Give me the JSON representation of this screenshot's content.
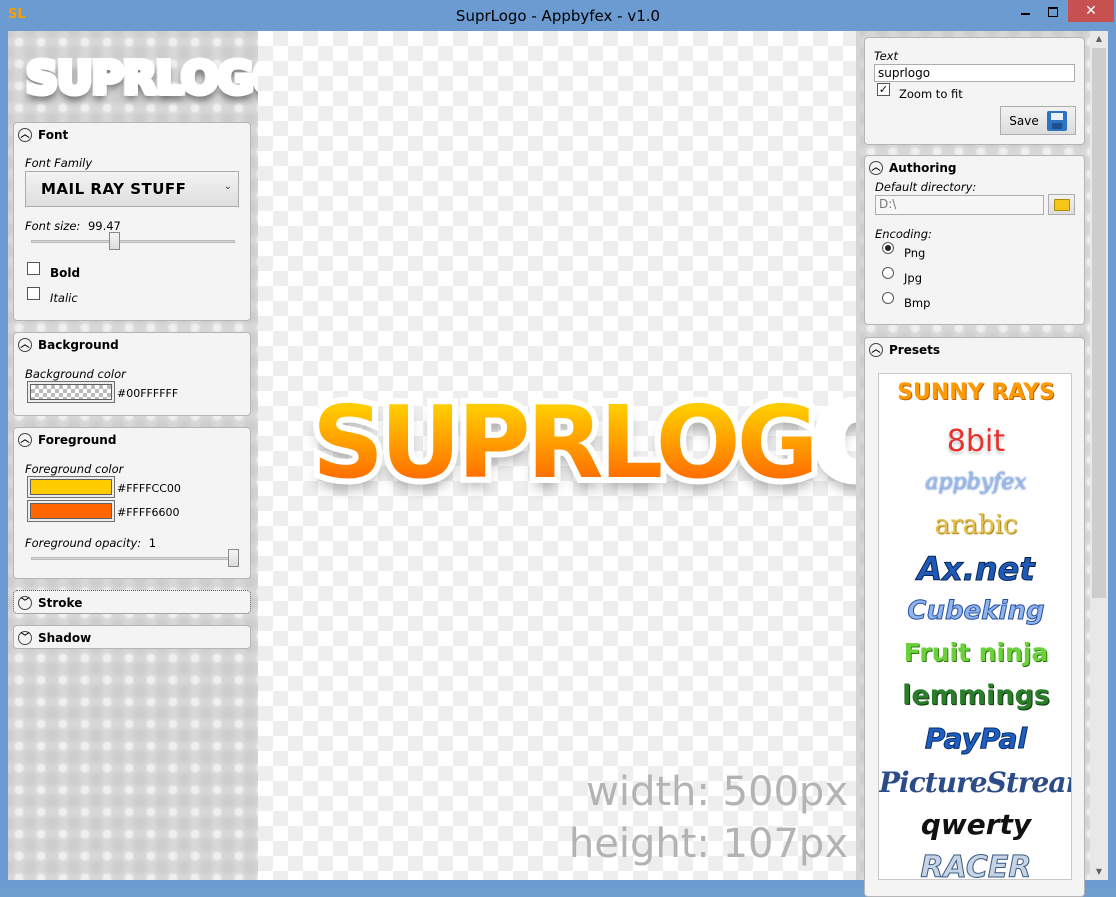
{
  "window": {
    "title": "SuprLogo - Appbyfex - v1.0",
    "close_glyph": "✕",
    "app_icon": "SL"
  },
  "left": {
    "logo": "SUPRLOGO",
    "font": {
      "header": "Font",
      "family_label": "Font Family",
      "family_value": "MAIL RAY STUFF",
      "size_label": "Font size:",
      "size_value": "99.47",
      "bold_label": "Bold",
      "italic_label": "Italic"
    },
    "background": {
      "header": "Background",
      "color_label": "Background color",
      "color_value": "#00FFFFFF"
    },
    "foreground": {
      "header": "Foreground",
      "color_label": "Foreground color",
      "color1_value": "#FFFFCC00",
      "color2_value": "#FFFF6600",
      "opacity_label": "Foreground opacity:",
      "opacity_value": "1"
    },
    "stroke": {
      "header": "Stroke"
    },
    "shadow": {
      "header": "Shadow"
    }
  },
  "canvas": {
    "logo_text": "SUPRLOGO",
    "width_text": "width: 500px",
    "height_text": "height: 107px"
  },
  "right": {
    "text_label": "Text",
    "text_value": "suprlogo",
    "zoom_label": "Zoom to fit",
    "zoom_checked": true,
    "save_label": "Save",
    "authoring": {
      "header": "Authoring",
      "dir_label": "Default directory:",
      "dir_value": "D:\\",
      "encoding_label": "Encoding:",
      "options": [
        "Png",
        "Jpg",
        "Bmp"
      ],
      "selected": "Png"
    },
    "presets": {
      "header": "Presets",
      "items": [
        "SUNNY RAYS",
        "8bit",
        "appbyfex",
        "arabic",
        "Ax.net",
        "Cubeking",
        "Fruit ninja",
        "lemmings",
        "PayPal",
        "PictureStream",
        "qwerty",
        "RACER"
      ]
    }
  },
  "colors": {
    "titlebar": "#6b9bd0",
    "close": "#c75050",
    "logo_orange": "#FF6600",
    "logo_yellow": "#FFCC00"
  }
}
